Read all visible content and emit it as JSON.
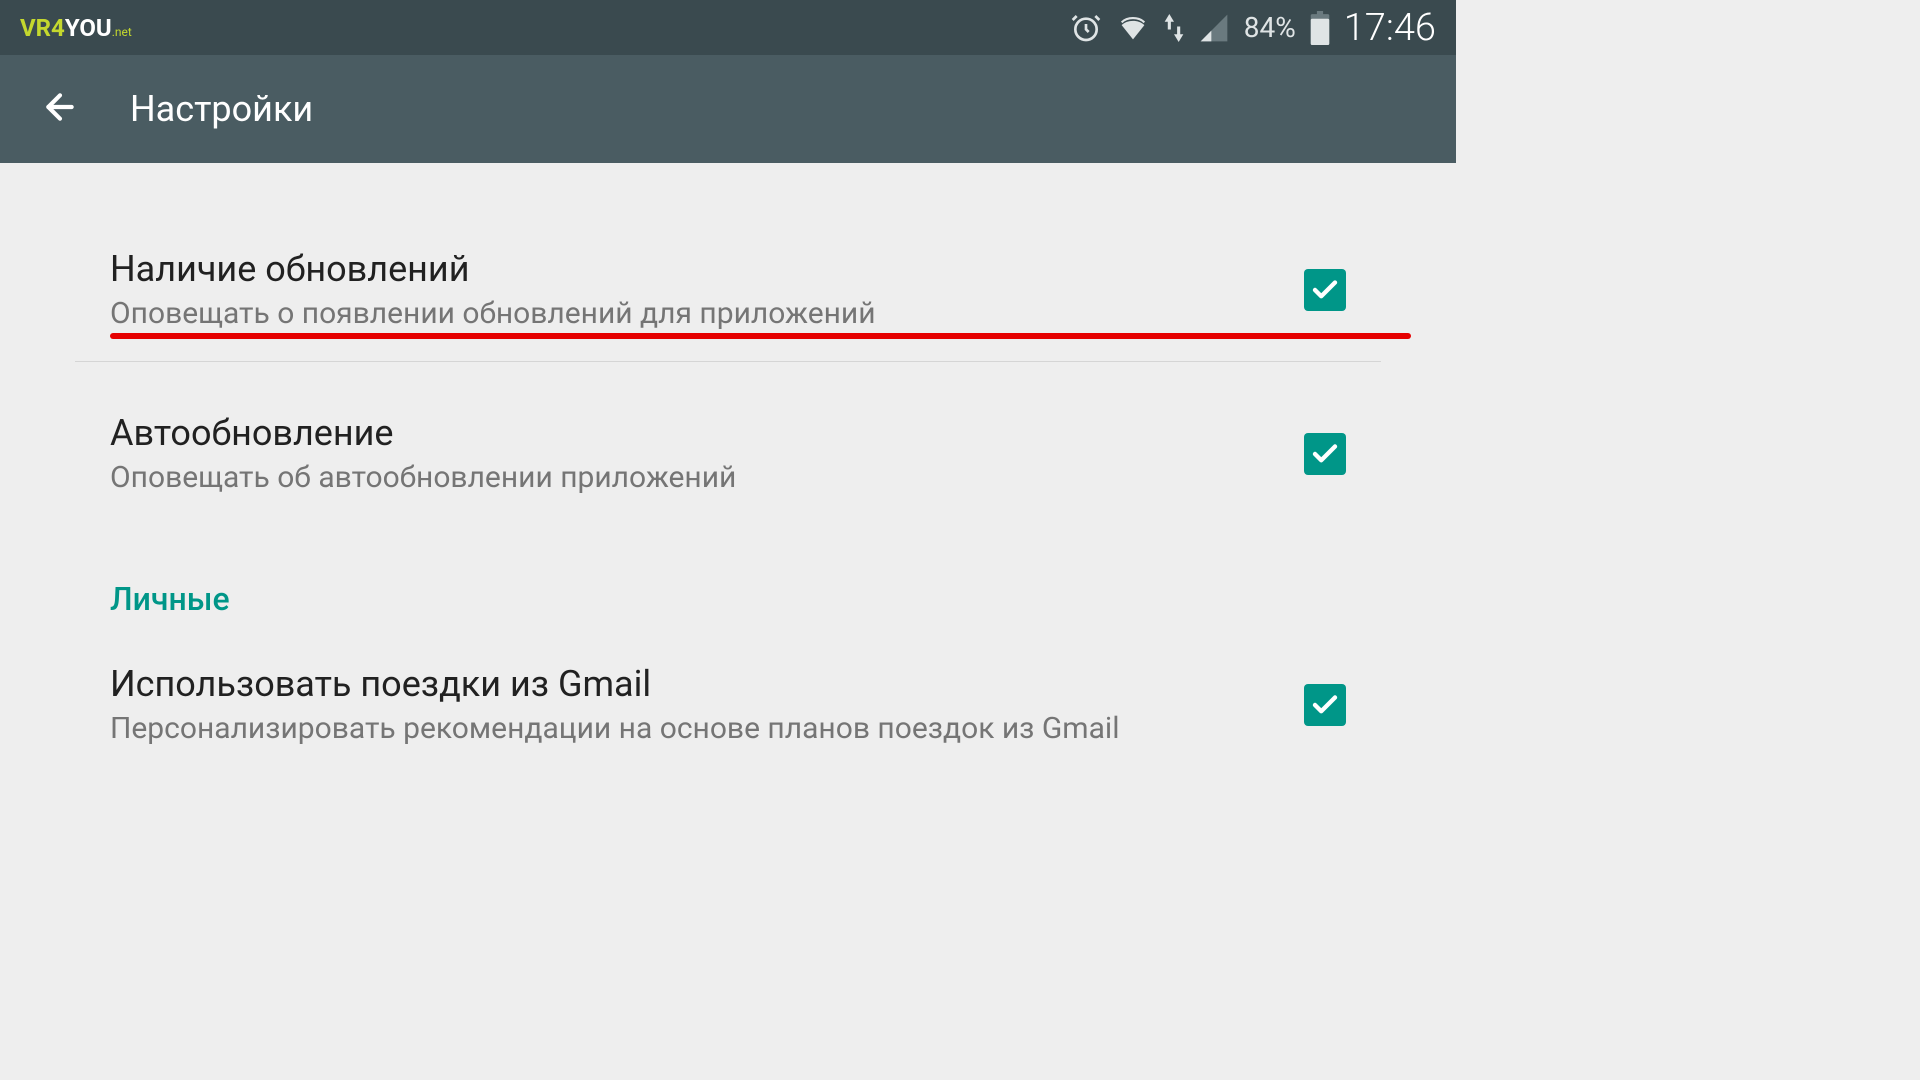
{
  "statusBar": {
    "logo": {
      "part1": "VR4",
      "part2": "YOU",
      "part3": ".net"
    },
    "battery": "84%",
    "clock": "17:46"
  },
  "appBar": {
    "title": "Настройки"
  },
  "settings": {
    "row1": {
      "title": "Наличие обновлений",
      "subtitle": "Оповещать о появлении обновлений для приложений"
    },
    "row2": {
      "title": "Автообновление",
      "subtitle": "Оповещать об автообновлении приложений"
    },
    "sectionHeader": "Личные",
    "row3": {
      "title": "Использовать поездки из Gmail",
      "subtitle": "Персонализировать рекомендации на основе планов поездок из Gmail"
    }
  }
}
